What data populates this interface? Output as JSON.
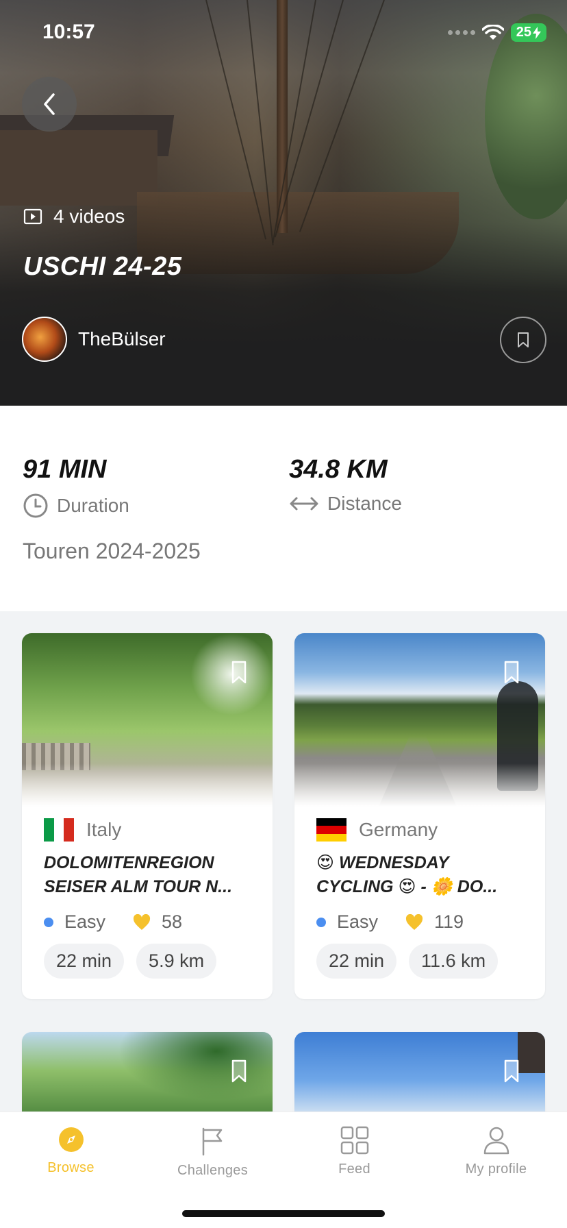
{
  "status_bar": {
    "time": "10:57",
    "battery": "25"
  },
  "collection": {
    "videos_label": "4 videos",
    "title": "USCHI 24-25",
    "author": "TheBülser",
    "duration_value": "91 MIN",
    "duration_label": "Duration",
    "distance_value": "34.8 KM",
    "distance_label": "Distance",
    "description": "Touren 2024-2025"
  },
  "cards": [
    {
      "country": "Italy",
      "title": "DOLOMITENREGION SEISER ALM TOUR N...",
      "difficulty": "Easy",
      "likes": "58",
      "time": "22 min",
      "distance": "5.9 km"
    },
    {
      "country": "Germany",
      "title": "😍 WEDNESDAY CYCLING 😍 - 🌼 DO...",
      "difficulty": "Easy",
      "likes": "119",
      "time": "22 min",
      "distance": "11.6 km"
    }
  ],
  "tabs": [
    {
      "label": "Browse",
      "icon": "compass-icon",
      "active": true
    },
    {
      "label": "Challenges",
      "icon": "flag-icon",
      "active": false
    },
    {
      "label": "Feed",
      "icon": "grid-icon",
      "active": false
    },
    {
      "label": "My profile",
      "icon": "person-icon",
      "active": false
    }
  ],
  "colors": {
    "accent": "#f5c12c",
    "easy": "#4b8ef0",
    "like": "#f5c12c"
  }
}
